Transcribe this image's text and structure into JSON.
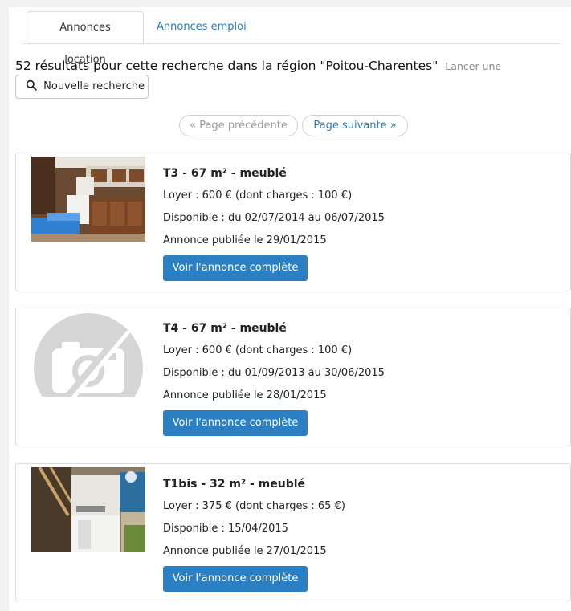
{
  "tabs": [
    {
      "label": "Annonces location"
    },
    {
      "label": "Annonces emploi"
    }
  ],
  "search": {
    "results_text": "52 résultats pour cette recherche dans la région \"Poitou-Charentes\"",
    "launch_text": "Lancer une",
    "new_search_label": "Nouvelle recherche"
  },
  "pagination": {
    "prev_label": "« Page précédente",
    "next_label": "Page suivante »"
  },
  "listings": [
    {
      "title": "T3 - 67 m² - meublé",
      "rent": "Loyer : 600 € (dont charges : 100 €)",
      "availability": "Disponible : du 02/07/2014 au 06/07/2015",
      "published": "Annonce publiée le 29/01/2015",
      "button": "Voir l'annonce complète",
      "image": "kitchen-photo"
    },
    {
      "title": "T4 - 67 m² - meublé",
      "rent": "Loyer : 600 € (dont charges : 100 €)",
      "availability": "Disponible : du 01/09/2013 au 30/06/2015",
      "published": "Annonce publiée le 28/01/2015",
      "button": "Voir l'annonce complète",
      "image": "no-photo-icon"
    },
    {
      "title": "T1bis - 32 m² - meublé",
      "rent": "Loyer : 375 € (dont charges : 65 €)",
      "availability": "Disponible : 15/04/2015",
      "published": "Annonce publiée le 27/01/2015",
      "button": "Voir l'annonce complète",
      "image": "studio-photo"
    }
  ],
  "colors": {
    "link": "#2a7ab9",
    "button": "#2b7fc3",
    "muted": "#888888"
  }
}
